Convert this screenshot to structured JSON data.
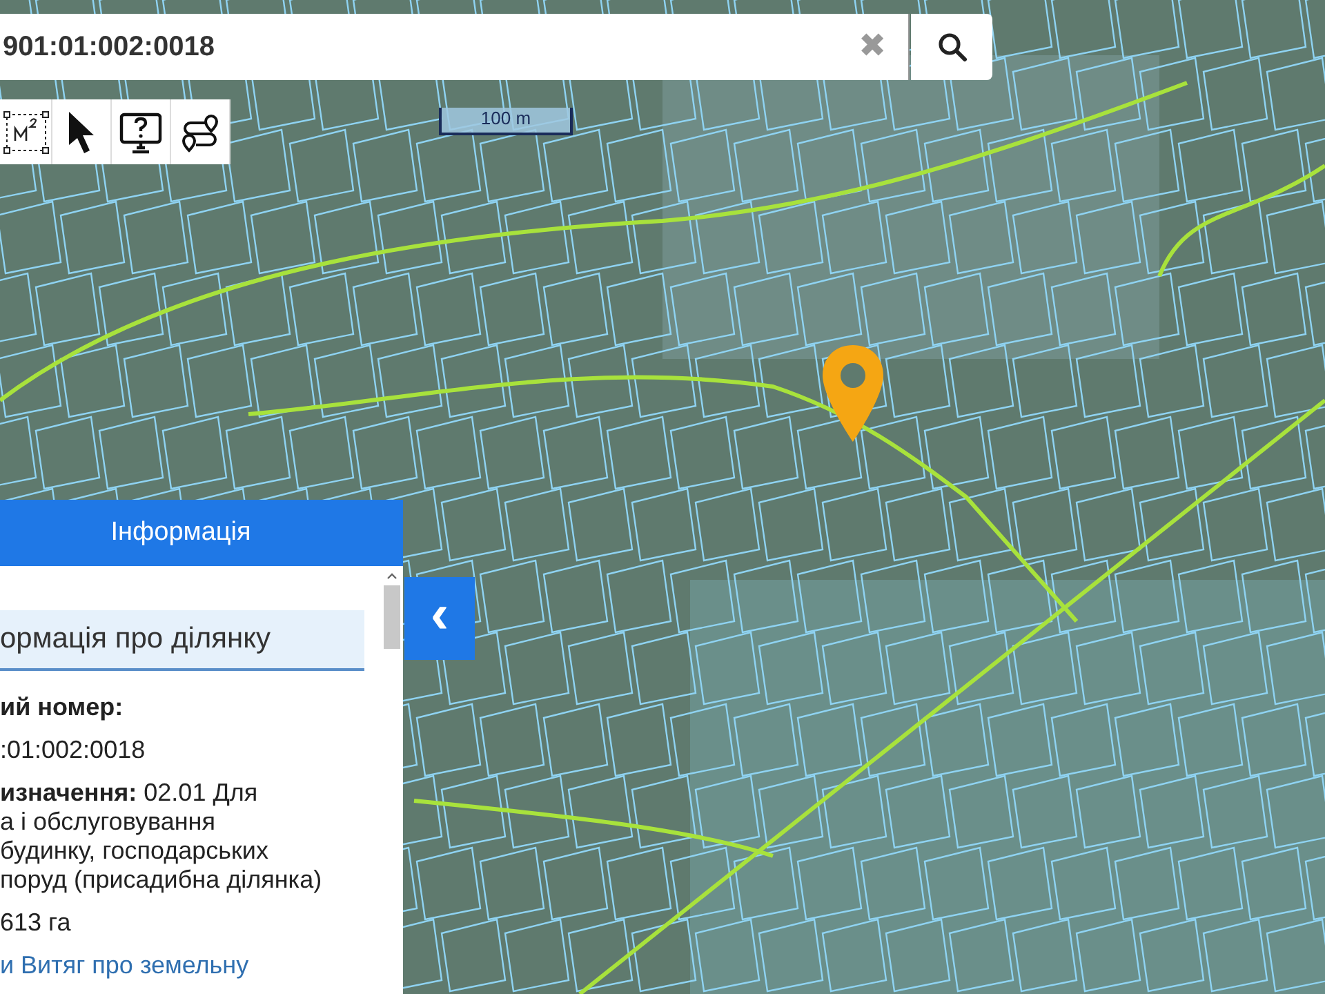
{
  "search": {
    "value": "901:01:002:0018",
    "clear_label": "✖"
  },
  "toolbar": [
    {
      "kind": "area"
    },
    {
      "kind": "pointer"
    },
    {
      "kind": "help"
    },
    {
      "kind": "route"
    }
  ],
  "scale_bar": {
    "label": "100 m"
  },
  "info_panel": {
    "title": "Інформація",
    "collapse_label": "‹",
    "section_title": "ормація про ділянку",
    "cadastral_label": "ий номер:",
    "cadastral_value": ":01:002:0018",
    "purpose_lines": [
      "**изначення:** 02.01 Для",
      "а і обслуговування",
      "будинку, господарських",
      "поруд (присадибна ділянка)"
    ],
    "area": "613 га",
    "extract_link": "и Витяг про земельну"
  }
}
